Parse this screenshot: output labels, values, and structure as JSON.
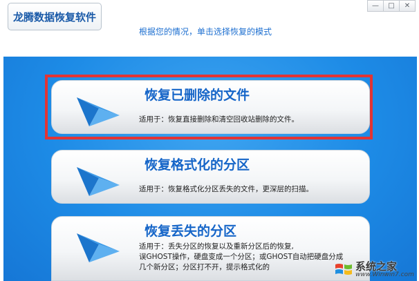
{
  "app": {
    "title": "龙腾数据恢复软件",
    "subtitle": "根据您的情况，单击选择恢复的模式"
  },
  "window_controls": {
    "minimize": "—",
    "maximize": "□",
    "close": "✕"
  },
  "options": [
    {
      "title": "恢复已删除的文件",
      "desc": "适用于：恢复直接删除和清空回收站删除的文件。",
      "selected": true
    },
    {
      "title": "恢复格式化的分区",
      "desc": "适用于：恢复格式化分区丢失的文件，更深层的扫描。",
      "selected": false
    },
    {
      "title": "恢复丢失的分区",
      "desc_lines": [
        "适用于：丢失分区的恢复以及重新分区后的恢复,",
        "误GHOST操作，硬盘变成一个分区；或GHOST自动把硬盘分成",
        "几个新分区；分区打不开，提示格式化的"
      ],
      "selected": false
    }
  ],
  "colors": {
    "accent": "#1565c8",
    "background": "#1d8be6",
    "selection": "#e23434"
  },
  "watermark": {
    "title": "系统之家",
    "url": "www.Winwin7.com"
  }
}
